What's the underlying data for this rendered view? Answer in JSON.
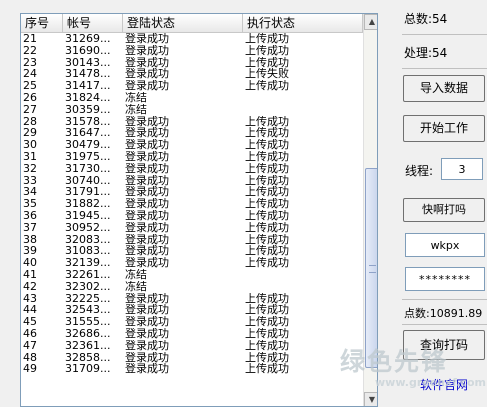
{
  "list": {
    "columns": [
      "序号",
      "帐号",
      "登陆状态",
      "执行状态"
    ],
    "rows": [
      [
        "21",
        "31269...",
        "登录成功",
        "上传成功"
      ],
      [
        "22",
        "31690...",
        "登录成功",
        "上传成功"
      ],
      [
        "23",
        "30143...",
        "登录成功",
        "上传成功"
      ],
      [
        "24",
        "31478...",
        "登录成功",
        "上传失败"
      ],
      [
        "25",
        "31417...",
        "登录成功",
        "上传成功"
      ],
      [
        "26",
        "31824...",
        "冻结",
        ""
      ],
      [
        "27",
        "30359...",
        "冻结",
        ""
      ],
      [
        "28",
        "31578...",
        "登录成功",
        "上传成功"
      ],
      [
        "29",
        "31647...",
        "登录成功",
        "上传成功"
      ],
      [
        "30",
        "30479...",
        "登录成功",
        "上传成功"
      ],
      [
        "31",
        "31975...",
        "登录成功",
        "上传成功"
      ],
      [
        "32",
        "31730...",
        "登录成功",
        "上传成功"
      ],
      [
        "33",
        "30740...",
        "登录成功",
        "上传成功"
      ],
      [
        "34",
        "31791...",
        "登录成功",
        "上传成功"
      ],
      [
        "35",
        "31882...",
        "登录成功",
        "上传成功"
      ],
      [
        "36",
        "31945...",
        "登录成功",
        "上传成功"
      ],
      [
        "37",
        "30952...",
        "登录成功",
        "上传成功"
      ],
      [
        "38",
        "32083...",
        "登录成功",
        "上传成功"
      ],
      [
        "39",
        "31083...",
        "登录成功",
        "上传成功"
      ],
      [
        "40",
        "32139...",
        "登录成功",
        "上传成功"
      ],
      [
        "41",
        "32261...",
        "冻结",
        ""
      ],
      [
        "42",
        "32302...",
        "冻结",
        ""
      ],
      [
        "43",
        "32225...",
        "登录成功",
        "上传成功"
      ],
      [
        "44",
        "32543...",
        "登录成功",
        "上传成功"
      ],
      [
        "45",
        "31555...",
        "登录成功",
        "上传成功"
      ],
      [
        "46",
        "32686...",
        "登录成功",
        "上传成功"
      ],
      [
        "47",
        "32361...",
        "登录成功",
        "上传成功"
      ],
      [
        "48",
        "32858...",
        "登录成功",
        "上传成功"
      ],
      [
        "49",
        "31709...",
        "登录成功",
        "上传成功"
      ]
    ]
  },
  "panel": {
    "total_label": "总数:54",
    "processed_label": "处理:54",
    "import_button": "导入数据",
    "start_button": "开始工作",
    "threads_label": "线程:",
    "threads_value": "3",
    "captcha_service_label": "快啊打吗",
    "username_value": "wkpx",
    "password_value": "********",
    "points_label": "点数:10891.89",
    "query_button": "查询打码",
    "software_link": "软件官网"
  },
  "watermark": {
    "brand": "绿色先锋",
    "url": "www.greenxf.com"
  }
}
